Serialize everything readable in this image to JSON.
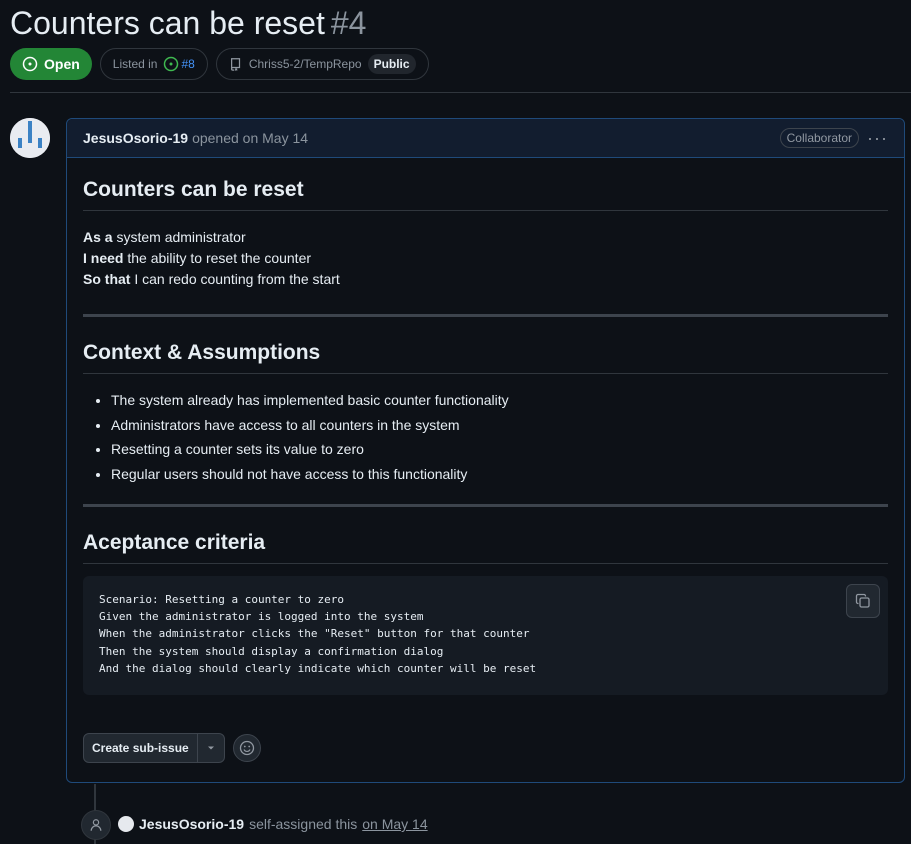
{
  "issue": {
    "title": "Counters can be reset",
    "number": "#4",
    "state": "Open",
    "listed_prefix": "Listed in",
    "listed_ref": "#8",
    "repo": "Chriss5-2/TempRepo",
    "visibility": "Public"
  },
  "comment": {
    "author": "JesusOsorio-19",
    "action": "opened on May 14",
    "role": "Collaborator",
    "heading1": "Counters can be reset",
    "story": [
      {
        "bold": "As a",
        "text": " system administrator"
      },
      {
        "bold": "I need",
        "text": " the ability to reset the counter"
      },
      {
        "bold": "So that",
        "text": " I can redo counting from the start"
      }
    ],
    "heading2": "Context & Assumptions",
    "assumptions": [
      "The system already has implemented basic counter functionality",
      "Administrators have access to all counters in the system",
      "Resetting a counter sets its value to zero",
      "Regular users should not have access to this functionality"
    ],
    "heading3": "Aceptance criteria",
    "code_lines": [
      "Scenario: Resetting a counter to zero",
      "Given the administrator is logged into the system",
      "When the administrator clicks the \"Reset\" button for that counter",
      "Then the system should display a confirmation dialog",
      "And the dialog should clearly indicate which counter will be reset"
    ],
    "create_subissue_label": "Create sub-issue"
  },
  "timeline": {
    "author": "JesusOsorio-19",
    "text": "self-assigned this",
    "date": "on May 14"
  },
  "colors": {
    "open_green": "#238636",
    "link_blue": "#4493f8",
    "bg": "#0d1117",
    "comment_border": "#1f4a7a"
  },
  "icons": [
    "issue-open-icon",
    "repo-icon",
    "kebab-icon",
    "copy-icon",
    "chevron-down-icon",
    "smiley-icon",
    "person-icon"
  ]
}
